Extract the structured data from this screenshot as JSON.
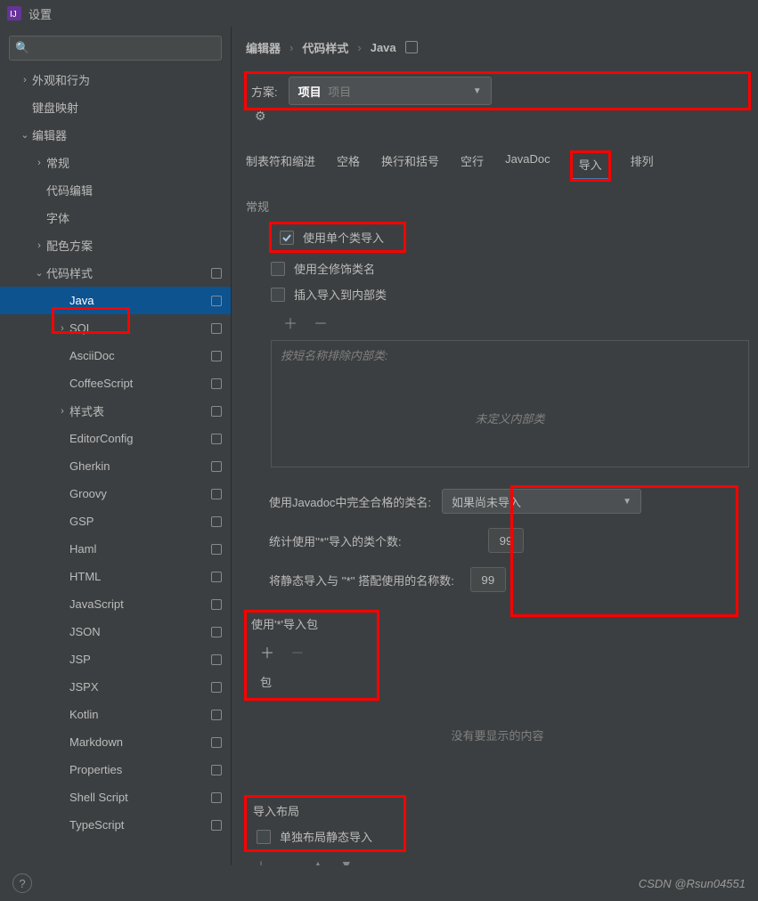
{
  "window": {
    "title": "设置"
  },
  "search": {
    "placeholder": ""
  },
  "sidebar": {
    "items": [
      {
        "label": "外观和行为",
        "depth": 0,
        "chev": ">",
        "dot": false
      },
      {
        "label": "键盘映射",
        "depth": 0,
        "chev": "",
        "dot": false
      },
      {
        "label": "编辑器",
        "depth": 0,
        "chev": "v",
        "dot": false
      },
      {
        "label": "常规",
        "depth": 1,
        "chev": ">",
        "dot": false
      },
      {
        "label": "代码编辑",
        "depth": 1,
        "chev": "",
        "dot": false
      },
      {
        "label": "字体",
        "depth": 1,
        "chev": "",
        "dot": false
      },
      {
        "label": "配色方案",
        "depth": 1,
        "chev": ">",
        "dot": false
      },
      {
        "label": "代码样式",
        "depth": 1,
        "chev": "v",
        "dot": true
      },
      {
        "label": "Java",
        "depth": 2,
        "chev": "",
        "dot": true,
        "selected": true
      },
      {
        "label": "SQL",
        "depth": 2,
        "chev": ">",
        "dot": true
      },
      {
        "label": "AsciiDoc",
        "depth": 2,
        "chev": "",
        "dot": true
      },
      {
        "label": "CoffeeScript",
        "depth": 2,
        "chev": "",
        "dot": true
      },
      {
        "label": "样式表",
        "depth": 2,
        "chev": ">",
        "dot": true
      },
      {
        "label": "EditorConfig",
        "depth": 2,
        "chev": "",
        "dot": true
      },
      {
        "label": "Gherkin",
        "depth": 2,
        "chev": "",
        "dot": true
      },
      {
        "label": "Groovy",
        "depth": 2,
        "chev": "",
        "dot": true
      },
      {
        "label": "GSP",
        "depth": 2,
        "chev": "",
        "dot": true
      },
      {
        "label": "Haml",
        "depth": 2,
        "chev": "",
        "dot": true
      },
      {
        "label": "HTML",
        "depth": 2,
        "chev": "",
        "dot": true
      },
      {
        "label": "JavaScript",
        "depth": 2,
        "chev": "",
        "dot": true
      },
      {
        "label": "JSON",
        "depth": 2,
        "chev": "",
        "dot": true
      },
      {
        "label": "JSP",
        "depth": 2,
        "chev": "",
        "dot": true
      },
      {
        "label": "JSPX",
        "depth": 2,
        "chev": "",
        "dot": true
      },
      {
        "label": "Kotlin",
        "depth": 2,
        "chev": "",
        "dot": true
      },
      {
        "label": "Markdown",
        "depth": 2,
        "chev": "",
        "dot": true
      },
      {
        "label": "Properties",
        "depth": 2,
        "chev": "",
        "dot": true
      },
      {
        "label": "Shell Script",
        "depth": 2,
        "chev": "",
        "dot": true
      },
      {
        "label": "TypeScript",
        "depth": 2,
        "chev": "",
        "dot": true
      }
    ]
  },
  "breadcrumb": {
    "a": "编辑器",
    "b": "代码样式",
    "c": "Java"
  },
  "scheme": {
    "label": "方案:",
    "value": "项目",
    "sub": "项目"
  },
  "tabs": {
    "items": [
      "制表符和缩进",
      "空格",
      "换行和括号",
      "空行",
      "JavaDoc",
      "导入",
      "排列"
    ],
    "active": 5
  },
  "general": {
    "title": "常规",
    "chk1": "使用单个类导入",
    "chk2": "使用全修饰类名",
    "chk3": "插入导入到内部类",
    "exclude_placeholder": "按短名称排除内部类:",
    "exclude_empty": "未定义内部类"
  },
  "javadoc": {
    "label": "使用Javadoc中完全合格的类名:",
    "dd": "如果尚未导入",
    "count1_label": "统计使用''*''导入的类个数:",
    "count1_val": "99",
    "count2_label": "将静态导入与 ''*'' 搭配使用的名称数:",
    "count2_val": "99"
  },
  "packages": {
    "title": "使用'*'导入包",
    "header": "包",
    "empty": "没有要显示的内容"
  },
  "layout": {
    "title": "导入布局",
    "chk": "单独布局静态导入"
  },
  "watermark": "CSDN @Rsun04551"
}
